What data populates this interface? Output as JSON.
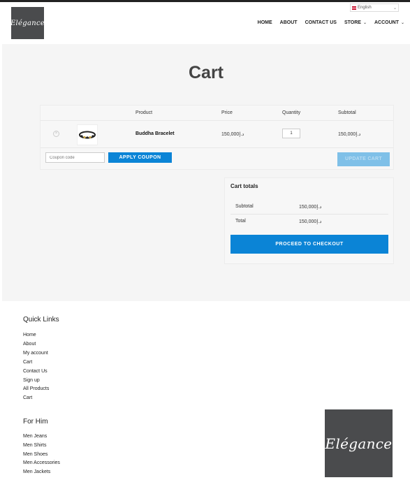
{
  "brand": {
    "logo_text": "Elégance"
  },
  "language": {
    "selected": "English"
  },
  "nav": {
    "items": [
      {
        "label": "HOME",
        "has_dropdown": false
      },
      {
        "label": "ABOUT",
        "has_dropdown": false
      },
      {
        "label": "CONTACT US",
        "has_dropdown": false
      },
      {
        "label": "STORE",
        "has_dropdown": true
      },
      {
        "label": "ACCOUNT",
        "has_dropdown": true
      }
    ]
  },
  "page": {
    "title": "Cart"
  },
  "cart": {
    "headers": {
      "product": "Product",
      "price": "Price",
      "quantity": "Quantity",
      "subtotal": "Subtotal"
    },
    "items": [
      {
        "name": "Buddha Bracelet",
        "price": "د.إ150,000",
        "quantity": "1",
        "subtotal": "د.إ150,000"
      }
    ],
    "coupon_placeholder": "Coupon code",
    "apply_coupon_label": "APPLY COUPON",
    "update_cart_label": "UPDATE CART"
  },
  "totals": {
    "title": "Cart totals",
    "subtotal_label": "Subtotal",
    "subtotal_value": "د.إ150,000",
    "total_label": "Total",
    "total_value": "د.إ150,000",
    "checkout_label": "PROCEED TO CHECKOUT"
  },
  "footer": {
    "quick_links_heading": "Quick Links",
    "quick_links": [
      "Home",
      "About",
      "My account",
      "Cart",
      "Contact Us",
      "Sign up",
      "All Products",
      "Cart"
    ],
    "for_him_heading": "For Him",
    "for_him_links": [
      "Men Jeans",
      "Men Shirts",
      "Men Shoes",
      "Men Accessories",
      "Men Jackets"
    ]
  },
  "colors": {
    "accent": "#0b84d6",
    "logo_bg": "#4a4b4d",
    "page_bg": "#f5f5f5"
  }
}
